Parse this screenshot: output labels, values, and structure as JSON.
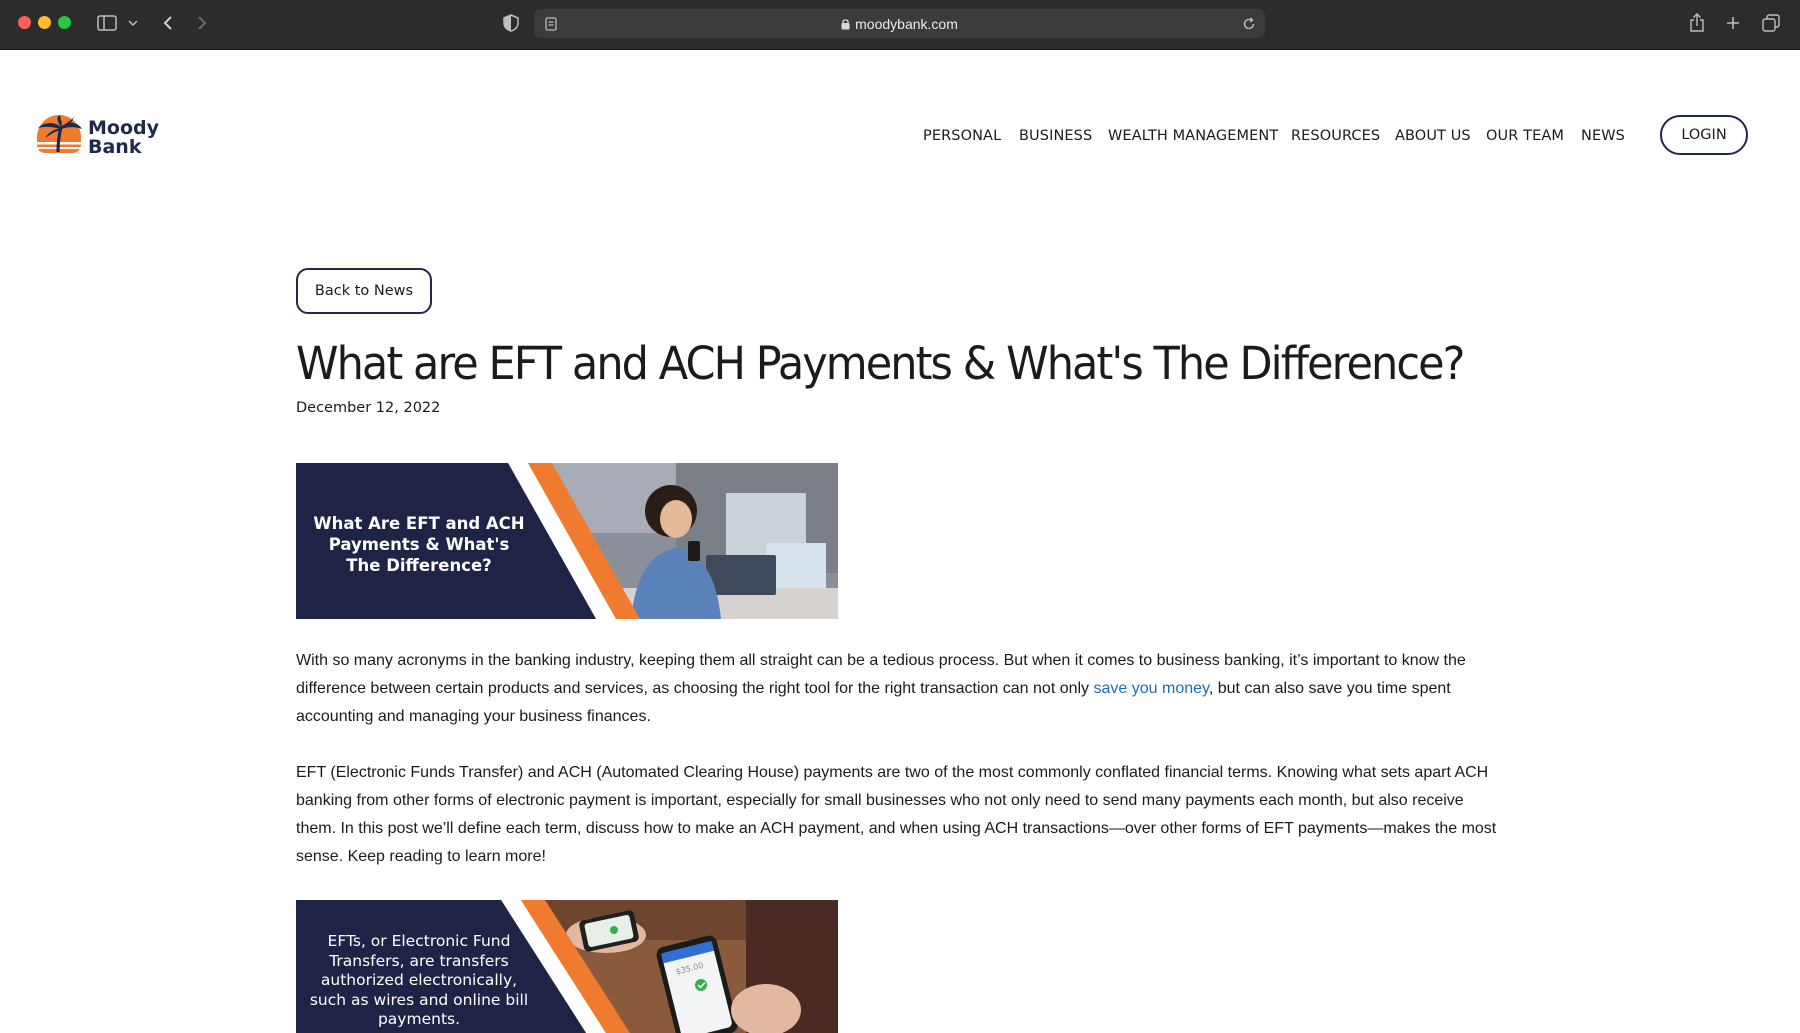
{
  "browser": {
    "url": "moodybank.com"
  },
  "site": {
    "logo_line1": "Moody",
    "logo_line2": "Bank",
    "nav": [
      "PERSONAL",
      "BUSINESS",
      "WEALTH MANAGEMENT",
      "RESOURCES",
      "ABOUT US",
      "OUR TEAM",
      "NEWS"
    ],
    "login_label": "LOGIN"
  },
  "article": {
    "back_label": "Back to News",
    "title": "What are EFT and ACH Payments & What's The Difference?",
    "date": "December 12, 2022",
    "banner1_lines": [
      "What Are EFT and ACH",
      "Payments & What's",
      "The Difference?"
    ],
    "para1_before": "With so many acronyms in the banking industry, keeping them all straight can be a tedious process. But when it comes to business banking, it’s important to know the difference between certain products and services, as choosing the right tool for the right transaction can not only ",
    "para1_link": "save you money",
    "para1_after": ", but can also save you time spent accounting and managing your business finances.",
    "para2": "EFT (Electronic Funds Transfer) and ACH (Automated Clearing House) payments are two of the most commonly conflated financial terms. Knowing what sets apart ACH banking from other forms of electronic payment is important, especially for small businesses who not only need to send many payments each month, but also receive them. In this post we’ll define each term, discuss how to make an ACH payment, and when using ACH transactions—over other forms of EFT payments—makes the most sense. Keep reading to learn more!",
    "banner2_lines": [
      "EFTs, or Electronic Fund",
      "Transfers, are transfers",
      "authorized electronically,",
      "such as wires and online bill",
      "payments."
    ],
    "banner2_phone_amount": "$35.00"
  },
  "colors": {
    "navy": "#1f2447",
    "orange": "#f07a2e",
    "link": "#1f6fb0"
  }
}
